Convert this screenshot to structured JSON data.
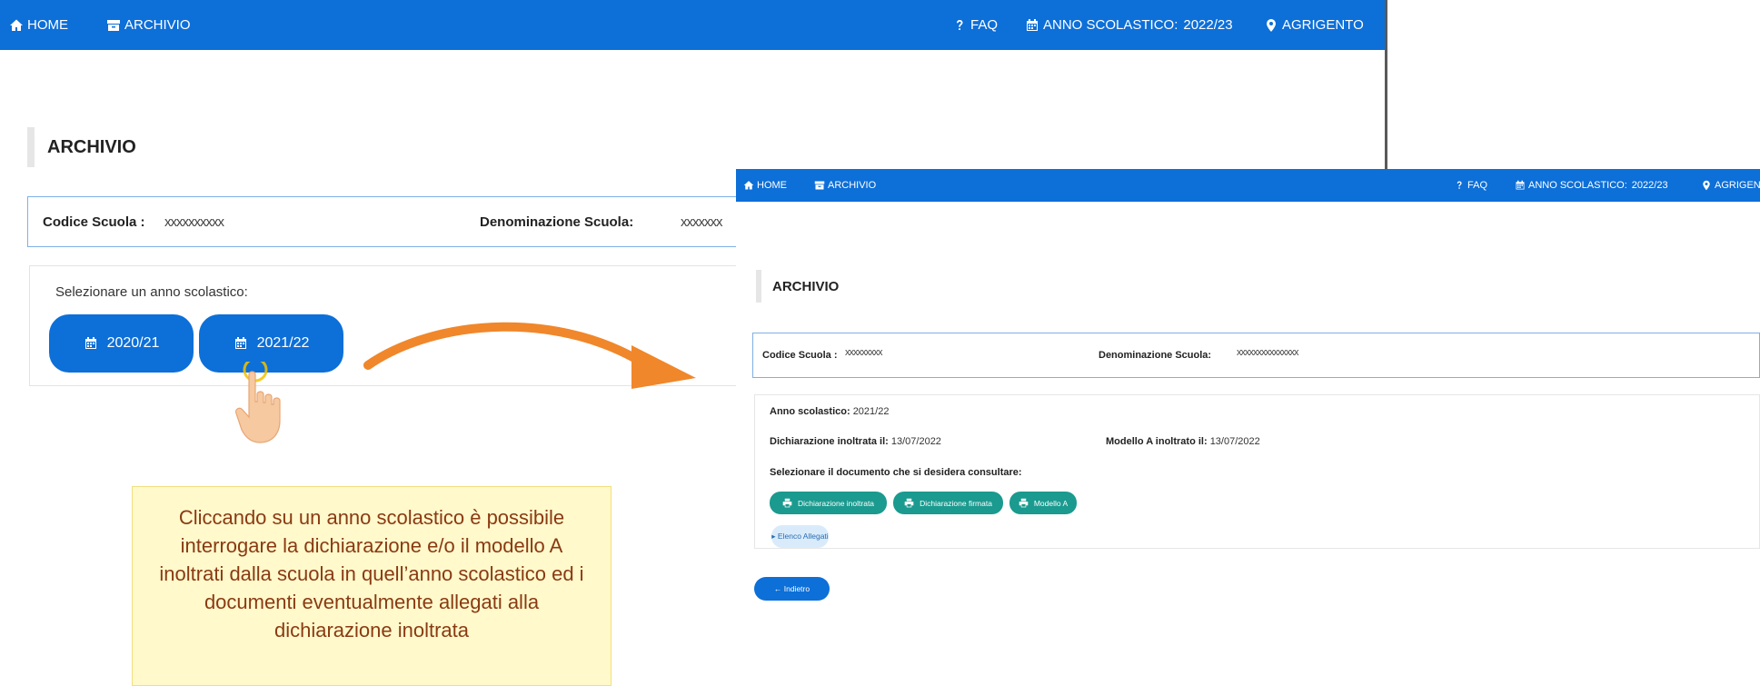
{
  "nav": {
    "home": "HOME",
    "archivio": "ARCHIVIO",
    "faq": "FAQ",
    "anno_label": "ANNO SCOLASTICO:",
    "anno_value": "2022/23",
    "location": "AGRIGENTO",
    "location_cut": "AGRIGENT"
  },
  "page": {
    "title": "ARCHIVIO"
  },
  "school": {
    "code_label": "Codice Scuola :",
    "code_value": "xxxxxxxxxx",
    "name_label": "Denominazione Scuola:",
    "name_value_cut": "xxxxxxx",
    "code_value_small": "xxxxxxxxx",
    "name_value_small": "xxxxxxxxxxxxxxx"
  },
  "select": {
    "label": "Selezionare un anno scolastico:",
    "years": [
      "2020/21",
      "2021/22"
    ]
  },
  "detail": {
    "anno_label": "Anno scolastico:",
    "anno_value": "2021/22",
    "dichiarazione_label": "Dichiarazione inoltrata il:",
    "dichiarazione_date": "13/07/2022",
    "modello_label": "Modello A inoltrato il:",
    "modello_date": "13/07/2022",
    "select_doc_label": "Selezionare il documento che si desidera consultare:",
    "doc_buttons": [
      "Dichiarazione inoltrata",
      "Dichiarazione firmata",
      "Modello A"
    ],
    "allegati": "▸ Elenco Allegati",
    "back": "← Indietro"
  },
  "note": "Cliccando su un anno scolastico è possibile interrogare la dichiarazione e/o il modello A inoltrati dalla scuola in quell’anno scolastico ed i documenti eventualmente allegati alla dichiarazione inoltrata",
  "icons": {
    "home": "home-icon",
    "archive": "archive-icon",
    "faq": "question-icon",
    "calendar": "calendar-icon",
    "location": "map-pin-icon",
    "print": "print-icon",
    "hand": "pointer-hand-icon",
    "arrow": "curved-arrow-icon"
  },
  "colors": {
    "nav_bg": "#0d6fd8",
    "year_button": "#0d6fd8",
    "doc_button": "#1b9a8f",
    "note_bg": "#fff9cc",
    "note_text": "#8a3a12",
    "arrow": "#f0872a"
  }
}
